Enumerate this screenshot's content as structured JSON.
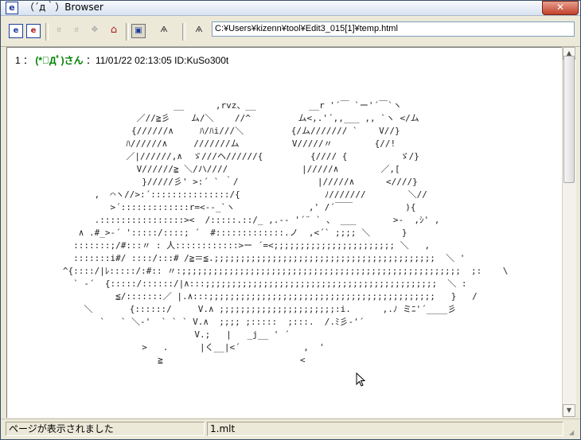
{
  "window": {
    "title": "（´д｀）Browser",
    "app_icon": "e",
    "close_label": "✕"
  },
  "toolbar": {
    "buttons": [
      {
        "name": "e-button",
        "glyph": "e"
      },
      {
        "name": "e-alt-button",
        "glyph": "e"
      },
      {
        "name": "aa-face-left-icon",
        "glyph": "ಠ"
      },
      {
        "name": "aa-face-right-icon",
        "glyph": "ಠ"
      },
      {
        "name": "stop-icon",
        "glyph": "✥"
      },
      {
        "name": "home-icon",
        "glyph": "⌂"
      },
      {
        "name": "thread-window-icon",
        "glyph": "▣"
      },
      {
        "name": "monar-face-icon",
        "glyph": "Ѧ"
      },
      {
        "name": "go-face-icon",
        "glyph": "Ѧ"
      }
    ],
    "address": "C:¥Users¥kizenn¥tool¥Edit3_015[1]¥temp.html"
  },
  "post": {
    "number": "1",
    "separator": "：",
    "name": "(*ﾟДﾟ)さん",
    "datetime": "：11/01/22 02:13:05 ID:KuSo300t",
    "aa": "                        __      ,rvz、__          __r '´￣ `ー'´￣`ヽ\n                 ／//≧彡    ム/＼    //^         ム<,.'´,,___ ,, `ヽ </ム\n                {//////∧     ﾊ/ﾊi///＼         {/ム/////// `    V//}\n               ﾊ//////∧     ///////ム          V/////〃        {//!\n               ／|//////,∧  ゞ///ヘ//////{         {//// {          ゞ/}\n                 V//////≧ ＼/ハ////              |/////∧        ／,[\n                  }/////彡' >:´ ` ｀/               |/////∧      <////}\n         ,  ⌒ヽ//>:´:::::::::::::::/{                ﾉ///////        ＼//\n            >´:::::::::::::r=<‐-_`ヽ              ,' /´￣￣          ){\n         .::::::::::::::::><  /:::::.::/_ ,.-‐ '´¨ ` 、 ___       >-  ,ｼ' ,\n      ∧ .#_>-´ ':::::/::::; ´  #:::::::::::::.ノ  ,<´` ;;;; ＼      }\n     :::::::;/#:::〃 : 人::::::::::::>ー ´=<;;;;;;;;;;;;;;;;;;;;;;; ＼   ,\n     :::::::i#/ ::::/:::# /≧＝≦.;;;;;;;;;;;;;;;;;;;;;;;;;;;;;;;;;;;;;;;;;;  ＼ '\n   ^{::::/|ﾚ:::::/:#:: 〃:;;;;;;;;;;;;;;;;;;;;;;;;;;;;;;;;;;;;;;;;;;;;;;;;;;;;;  ;:    \\\n     ` ‐´  {:::::/::::::/|∧:::;;;;;;;;;;;;;;;;;;;;;;;;;;;;;;;;;;;;;;;;;;;;  ＼ :\n             ≦/:::::::／ |.∧:::;;;;;;;;;;;;;;;;;;;;;;;;;;;;;;;;;;;;;;;;;;;   }   /\n       ＼       {::::::/     V.∧ ;;;;;;;;;;;;;;;;;;;;;;:i.      ,.ﾉ ミﾆ'´____彡\n          `   ` ＼‐'  ` ` ` V.∧  ;;;; ;:::::  ;:::.  /.ﾐ彡-'´     \n                            V.;   |   _j__ ' ´\n                  >   .      |く__|<´            ,  '\n                     ≧                          <"
  },
  "status": {
    "message": "ページが表示されました",
    "file": "1.mlt"
  }
}
